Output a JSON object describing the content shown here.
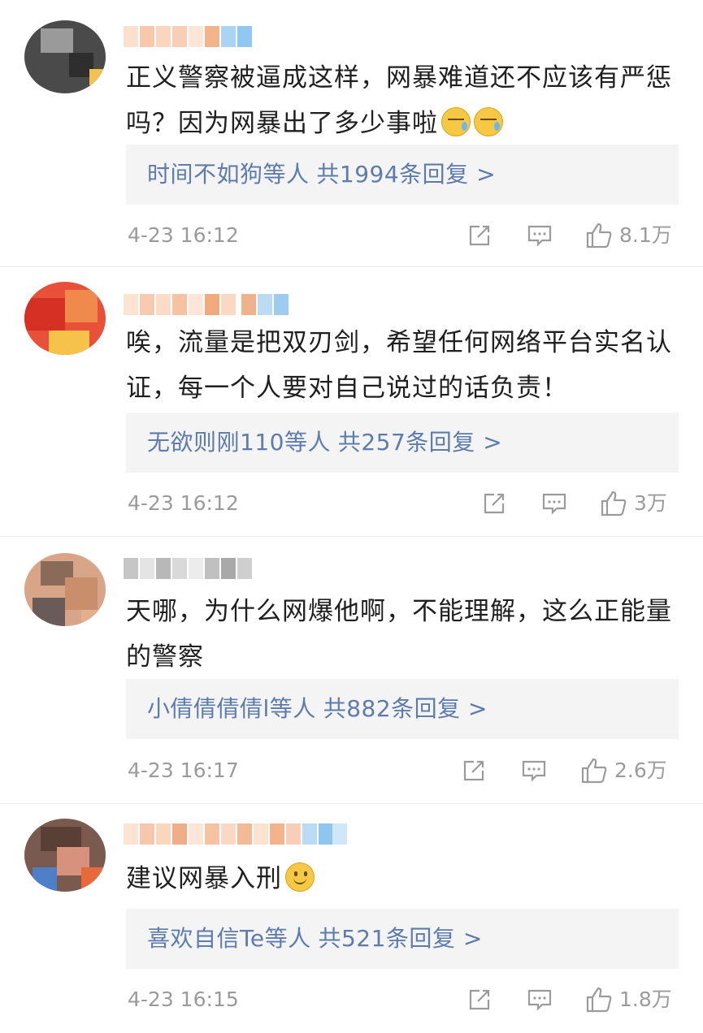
{
  "comments": [
    {
      "text": "正义警察被逼成这样，网暴难道还不应该有严惩吗？因为网暴出了多少事啦",
      "emojis": [
        "cry",
        "cry"
      ],
      "reply_users": "时间不如狗等人",
      "reply_count": "共1994条回复 >",
      "time": "4-23 16:12",
      "likes": "8.1万",
      "avatar_colors": [
        "#3a3a3a",
        "#8a8a8a",
        "#f2c14e"
      ],
      "name_colors": [
        "#f7c9a8",
        "#f3b48c",
        "#8fc8f0"
      ]
    },
    {
      "text": "唉，流量是把双刃剑，希望任何网络平台实名认证，每一个人要对自己说过的话负责！",
      "emojis": [],
      "reply_users": "无欲则刚110等人",
      "reply_count": "共257条回复 >",
      "time": "4-23 16:12",
      "likes": "3万",
      "avatar_colors": [
        "#e23b2b",
        "#f07a3c",
        "#f6c24a"
      ],
      "name_colors": [
        "#f6c3a2",
        "#f2a97c",
        "#9ccdf0"
      ]
    },
    {
      "text": "天哪，为什么网爆他啊，不能理解，这么正能量的警察",
      "emojis": [],
      "reply_users": "小倩倩倩倩l等人",
      "reply_count": "共882条回复 >",
      "time": "4-23 16:17",
      "likes": "2.6万",
      "avatar_colors": [
        "#c98f6c",
        "#8a6b5a",
        "#e2b08e"
      ],
      "name_colors": [
        "#c6c6c6",
        "#a9a9a9",
        "#dcdcdc"
      ]
    },
    {
      "text": "建议网暴入刑",
      "emojis": [
        "smile"
      ],
      "reply_users": "喜欢自信Te等人",
      "reply_count": "共521条回复 >",
      "time": "4-23 16:15",
      "likes": "1.8万",
      "avatar_colors": [
        "#5a3f36",
        "#d6927c",
        "#4f7fc8"
      ],
      "name_colors": [
        "#f7c6ae",
        "#f0ad88",
        "#8ec6f0"
      ]
    }
  ],
  "colors": {
    "link": "#5d7bab",
    "meta": "#9b9b9b",
    "reply_bg": "#f4f4f4"
  },
  "icons": {
    "share": "share-icon",
    "comment": "comment-icon",
    "like": "thumbs-up-icon"
  }
}
